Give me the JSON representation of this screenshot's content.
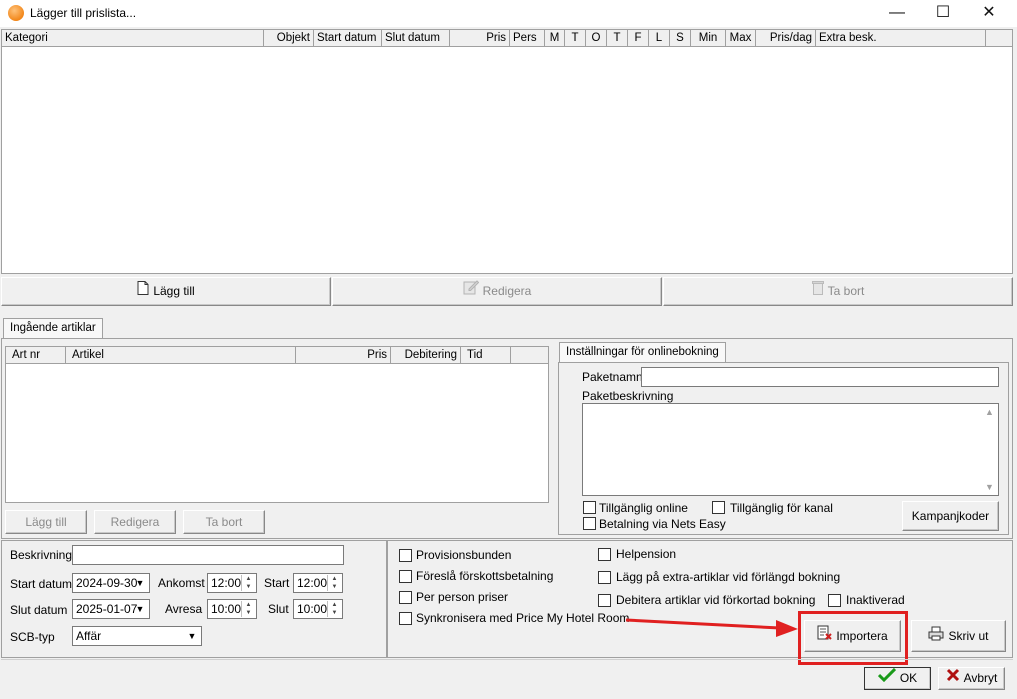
{
  "window": {
    "title": "Lägger till prislista...",
    "minimize": "—",
    "maximize": "☐",
    "close": "✕"
  },
  "price_grid": {
    "columns": [
      "Kategori",
      "Objekt",
      "Start datum",
      "Slut datum",
      "Pris",
      "Pers",
      "M",
      "T",
      "O",
      "T",
      "F",
      "L",
      "S",
      "Min",
      "Max",
      "Pris/dag",
      "Extra besk."
    ]
  },
  "grid_buttons": {
    "add": "Lägg till",
    "edit": "Redigera",
    "remove": "Ta bort"
  },
  "articles_tab": {
    "tab_label": "Ingående artiklar",
    "columns": [
      "Art nr",
      "Artikel",
      "Pris",
      "Debitering",
      "Tid"
    ],
    "buttons": {
      "add": "Lägg till",
      "edit": "Redigera",
      "remove": "Ta bort"
    }
  },
  "online_booking": {
    "tab_label": "Inställningar för onlinebokning",
    "package_name_label": "Paketnamn",
    "package_name_value": "",
    "package_desc_label": "Paketbeskrivning",
    "available_online": "Tillgänglig online",
    "available_channel": "Tillgänglig för kanal",
    "nets_easy": "Betalning via Nets Easy",
    "campaign_codes": "Kampanjkoder"
  },
  "form": {
    "description_label": "Beskrivning",
    "description_value": "",
    "start_date_label": "Start datum",
    "start_date_value": "2024-09-30",
    "end_date_label": "Slut datum",
    "end_date_value": "2025-01-07",
    "arrival_label": "Ankomst",
    "arrival_value": "12:00",
    "departure_label": "Avresa",
    "departure_value": "10:00",
    "start_label": "Start",
    "start_value": "12:00",
    "end_label": "Slut",
    "end_value": "10:00",
    "scb_label": "SCB-typ",
    "scb_value": "Affär"
  },
  "options": {
    "commission": "Provisionsbunden",
    "prepayment": "Föreslå förskottsbetalning",
    "per_person": "Per person priser",
    "sync": "Synkronisera med Price My Hotel Room",
    "full_board": "Helpension",
    "extend_articles": "Lägg på extra-artiklar vid förlängd bokning",
    "shorten_articles": "Debitera artiklar vid förkortad bokning",
    "inactive": "Inaktiverad"
  },
  "actions": {
    "import": "Importera",
    "print": "Skriv ut",
    "ok": "OK",
    "cancel": "Avbryt"
  },
  "colors": {
    "highlight": "#e02020",
    "ok_check": "#1a9a1a",
    "cancel_x": "#b01010"
  }
}
